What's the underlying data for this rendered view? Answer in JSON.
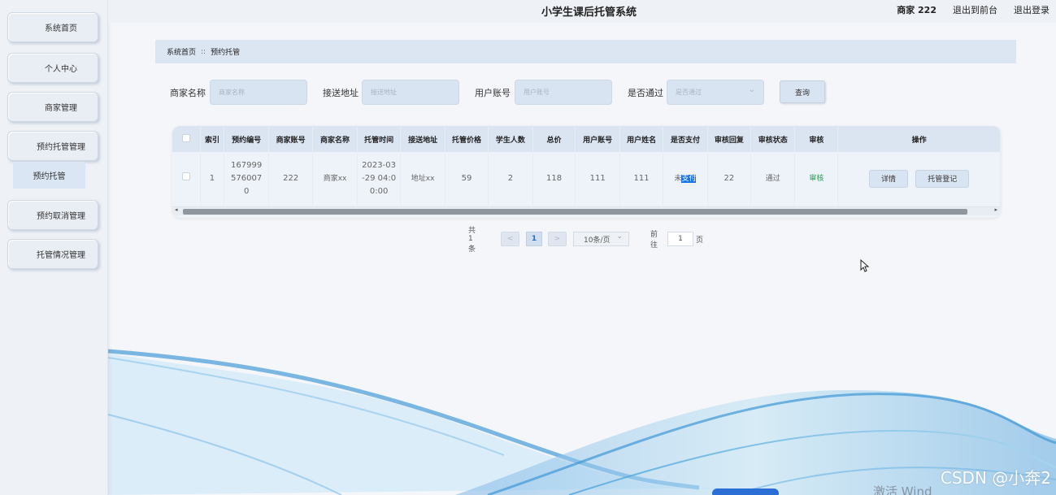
{
  "app": {
    "title": "小学生课后托管系统"
  },
  "header": {
    "user": "商家 222",
    "back_front": "退出到前台",
    "logout": "退出登录"
  },
  "sidebar": {
    "items": [
      {
        "label": "系统首页"
      },
      {
        "label": "个人中心"
      },
      {
        "label": "商家管理"
      },
      {
        "label": "预约托管管理"
      },
      {
        "label": "预约取消管理"
      },
      {
        "label": "托管情况管理"
      }
    ],
    "submenu": {
      "label": "预约托管"
    }
  },
  "breadcrumb": {
    "home": "系统首页",
    "sep": "::",
    "current": "预约托管"
  },
  "search": {
    "merchant_name_label": "商家名称",
    "merchant_name_placeholder": "商家名称",
    "address_label": "接送地址",
    "address_placeholder": "接送地址",
    "user_account_label": "用户账号",
    "user_account_placeholder": "用户账号",
    "approved_label": "是否通过",
    "approved_placeholder": "是否通过",
    "query_button": "查询"
  },
  "table": {
    "columns": [
      "索引",
      "预约编号",
      "商家账号",
      "商家名称",
      "托管时间",
      "接送地址",
      "托管价格",
      "学生人数",
      "总价",
      "用户账号",
      "用户姓名",
      "是否支付",
      "审核回复",
      "审核状态",
      "审核",
      "操作"
    ],
    "rows": [
      {
        "index": "1",
        "order_no": "1679995760070",
        "merchant_account": "222",
        "merchant_name": "商家xx",
        "time": "2023-03-29 04:00:00",
        "address": "地址xx",
        "price": "59",
        "students": "2",
        "total": "118",
        "user_account": "111",
        "user_name": "111",
        "paid_prefix": "未",
        "paid_selected": "支付",
        "reply": "22",
        "status": "通过",
        "audit": "审核",
        "detail_button": "详情",
        "register_button": "托管登记"
      }
    ]
  },
  "pagination": {
    "total": "共 1 条",
    "prev": "<",
    "current_page": "1",
    "next": ">",
    "page_size": "10条/页",
    "goto": "前往",
    "goto_value": "1",
    "page_unit": "页"
  },
  "overlay": {
    "watermark": "CSDN @小奔2",
    "activate": "激活 Wind"
  }
}
